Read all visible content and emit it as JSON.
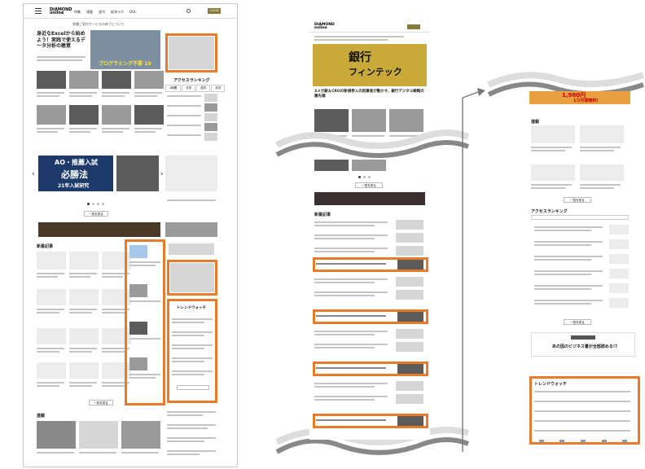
{
  "panel1": {
    "site_logo": "DIAMOND online",
    "nav_items": [
      "特集",
      "連載",
      "週刊",
      "経済ラボ",
      "DOL"
    ],
    "login_label": "LOGIN",
    "notice": "各種ご案内サービスの終了について",
    "hero_headline": "身近なExcelから始めよう！実践で使えるデータ分析の極意",
    "hero_banner_text": "プログラミング不要 10",
    "access_ranking_title": "アクセスランキング",
    "ranking_tabs": [
      "1時間",
      "日次",
      "週次",
      "月次"
    ],
    "ad_slogan": [
      "AO・推薦入試",
      "必勝法",
      "21年入試研究"
    ],
    "latest_title": "新着記事",
    "trend_title": "トレンドウォッチ",
    "more_label": "一覧を見る",
    "series_title": "連載"
  },
  "panel2": {
    "logo": "DIAMOND online",
    "hero_text": [
      "銀行",
      "フィンテック"
    ],
    "hero_caption": "3メガ銀＆CROの新規参入の起業者が動かす、銀行デジタル戦略の最先端",
    "more_label": "一覧を見る",
    "latest_title": "新着記事"
  },
  "panel3": {
    "banner_text": "1,980円",
    "banner_sub": "1カ月間無料!",
    "series_title": "連載",
    "access_ranking_title": "アクセスランキング",
    "more_label": "一覧を見る",
    "survey_text": "あの国のビジネス書が全部読める!?",
    "trend_title": "トレンドウォッチ"
  }
}
